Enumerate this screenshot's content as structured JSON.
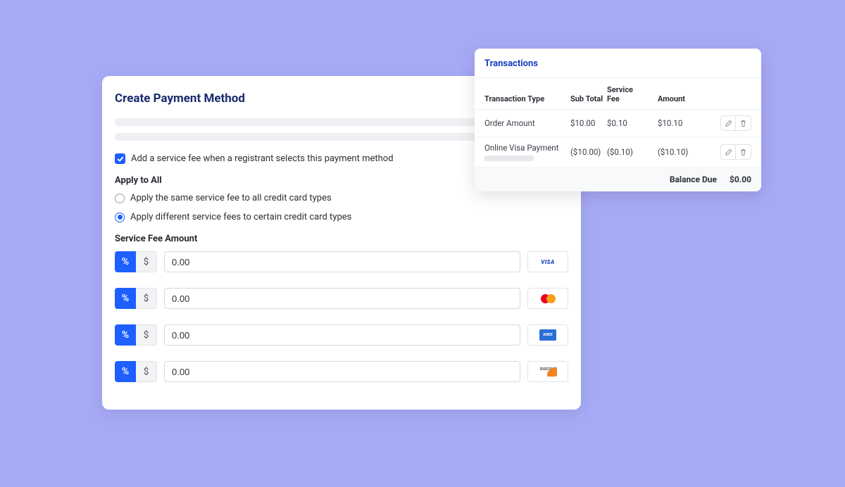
{
  "main": {
    "title": "Create Payment Method",
    "addFeeLabel": "Add a service fee when a registrant selects this payment method",
    "applyToAllHeading": "Apply to All",
    "radioSameLabel": "Apply the same service fee to all credit card types",
    "radioDiffLabel": "Apply different service fees to certain credit card types",
    "serviceFeeHeading": "Service Fee Amount",
    "percentSymbol": "%",
    "dollarSymbol": "$",
    "fees": [
      {
        "value": "0.00",
        "card": "visa"
      },
      {
        "value": "0.00",
        "card": "mastercard"
      },
      {
        "value": "0.00",
        "card": "amex"
      },
      {
        "value": "0.00",
        "card": "discover"
      }
    ]
  },
  "tx": {
    "title": "Transactions",
    "cols": {
      "type": "Transaction Type",
      "sub": "Sub Total",
      "fee": "Service Fee",
      "amt": "Amount"
    },
    "rows": [
      {
        "type": "Order Amount",
        "sub": "$10.00",
        "fee": "$0.10",
        "amt": "$10.10"
      },
      {
        "type": "Online Visa Payment",
        "sub": "($10.00)",
        "fee": "($0.10)",
        "amt": "($10.10)"
      }
    ],
    "balanceLabel": "Balance Due",
    "balanceValue": "$0.00"
  },
  "cardLabels": {
    "visa": "VISA",
    "amex": "AMEX",
    "discover": "DISCOVER"
  }
}
